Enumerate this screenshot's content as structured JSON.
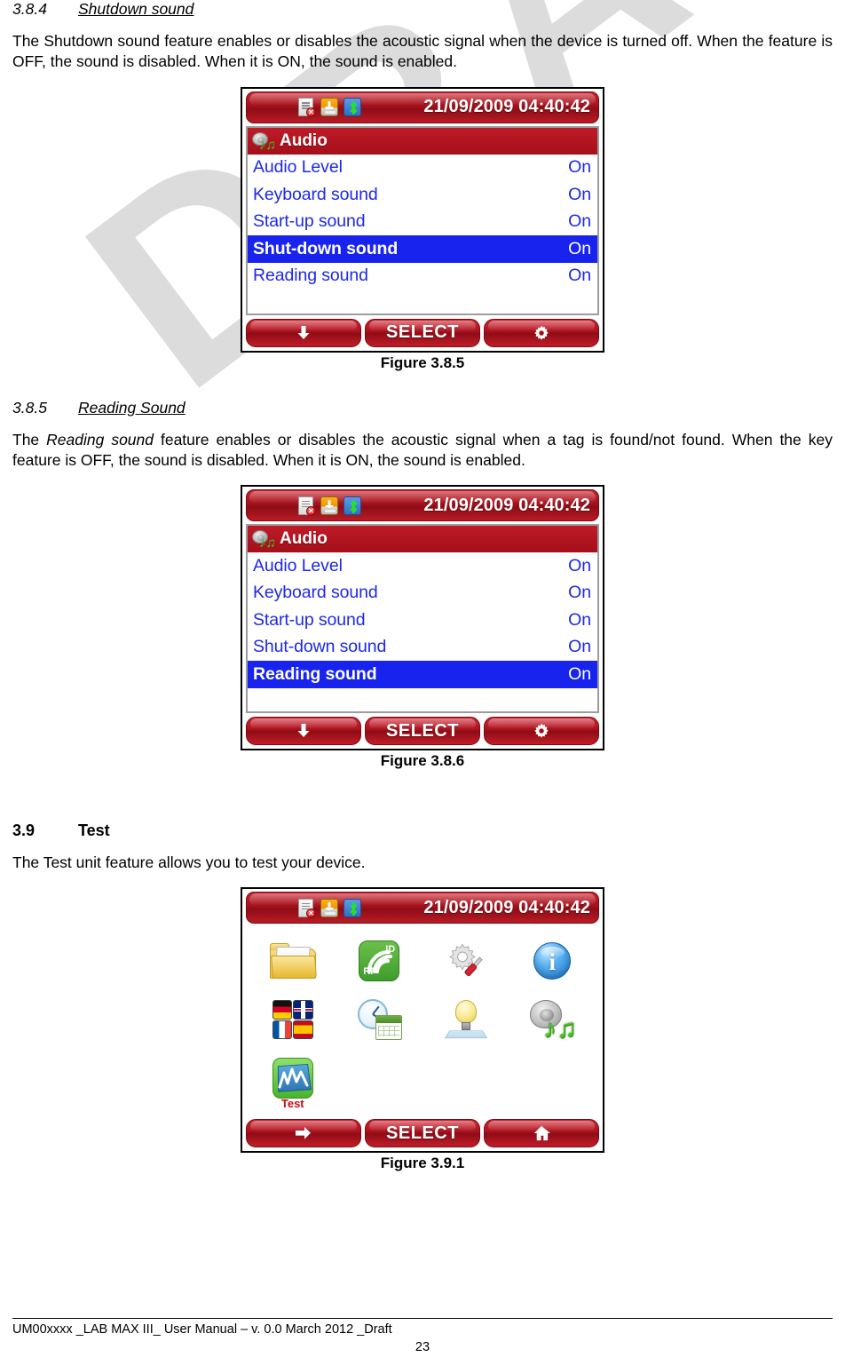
{
  "watermark": {
    "text": "DRAFT"
  },
  "sections": [
    {
      "number": "3.8.4",
      "title": "Shutdown sound",
      "heading_level": "h3",
      "body": "The Shutdown sound feature enables or disables the acoustic signal when the device is turned off. When the feature is OFF, the sound is disabled. When it is ON, the sound is enabled."
    },
    {
      "number": "3.8.5",
      "title": "Reading Sound",
      "heading_level": "h3",
      "body_pre": "The ",
      "body_em": "Reading sound",
      "body_post": " feature enables or disables the acoustic signal when a tag is found/not found. When the key feature is OFF, the sound is disabled. When it is ON, the sound is enabled."
    },
    {
      "number": "3.9",
      "title": "Test",
      "heading_level": "h2",
      "body": "The Test unit feature allows you to test your device."
    }
  ],
  "figures": [
    {
      "caption": "Figure 3.8.5"
    },
    {
      "caption": "Figure 3.8.6"
    },
    {
      "caption": "Figure 3.9.1"
    }
  ],
  "device": {
    "statusbar": {
      "datetime": "21/09/2009 04:40:42",
      "icons": [
        {
          "name": "file-error-icon",
          "badge": "✕"
        },
        {
          "name": "usb-icon"
        },
        {
          "name": "bluetooth-icon"
        }
      ]
    },
    "audio_menu": {
      "title": "Audio",
      "title_icon": "speaker-music-icon",
      "rows": [
        {
          "label": "Audio Level",
          "value": "On"
        },
        {
          "label": "Keyboard sound",
          "value": "On"
        },
        {
          "label": "Start-up sound",
          "value": "On"
        },
        {
          "label": "Shut-down sound",
          "value": "On"
        },
        {
          "label": "Reading sound",
          "value": "On"
        }
      ]
    },
    "screen1_selected_index": 3,
    "screen2_selected_index": 4,
    "buttons_menu": [
      {
        "name": "down-arrow-button",
        "label": ""
      },
      {
        "name": "select-button",
        "label": "SELECT"
      },
      {
        "name": "settings-gear-button",
        "label": ""
      }
    ],
    "buttons_home": [
      {
        "name": "right-arrow-button",
        "label": ""
      },
      {
        "name": "select-button",
        "label": "SELECT"
      },
      {
        "name": "home-button",
        "label": ""
      }
    ],
    "home_grid": [
      {
        "name": "folder-icon",
        "caption": ""
      },
      {
        "name": "rfid-icon",
        "caption": "",
        "label_top": "ID",
        "label_bottom": "RF"
      },
      {
        "name": "settings-gear-screwdriver-icon",
        "caption": ""
      },
      {
        "name": "info-icon",
        "caption": "",
        "glyph": "i"
      },
      {
        "name": "language-flags-icon",
        "caption": ""
      },
      {
        "name": "clock-calendar-icon",
        "caption": ""
      },
      {
        "name": "light-bulb-icon",
        "caption": ""
      },
      {
        "name": "speaker-music-icon",
        "caption": ""
      },
      {
        "name": "test-chart-icon",
        "caption": "Test"
      }
    ]
  },
  "footer": {
    "text": "UM00xxxx _LAB MAX III_ User Manual – v. 0.0 March 2012 _Draft",
    "page_number": "23"
  },
  "colors": {
    "device_red": "#a40f1a",
    "selected_blue": "#1823ed",
    "menu_text_blue": "#1d28e8",
    "watermark_gray": "#dcdcdc",
    "test_label_red": "#cc0a18"
  }
}
